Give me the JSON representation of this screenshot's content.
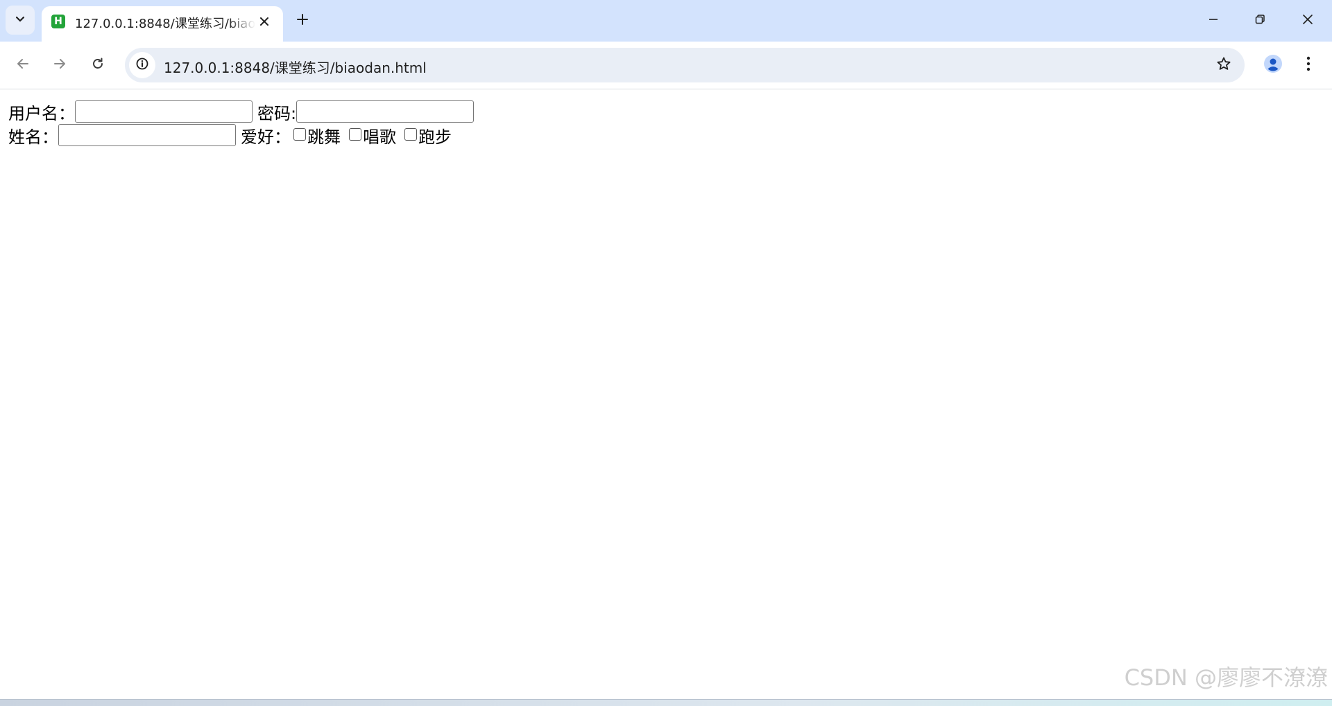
{
  "browser": {
    "tab": {
      "title": "127.0.0.1:8848/课堂练习/biaodan.html",
      "favicon_letter": "H",
      "favicon_color": "#23a43a"
    },
    "address_bar": {
      "url": "127.0.0.1:8848/课堂练习/biaodan.html"
    },
    "tab_strip_color": "#d3e3fd",
    "profile_color": "#1a56c4"
  },
  "form": {
    "username_label": "用户名：",
    "password_label": "密码:",
    "name_label": "姓名：",
    "hobby_label": "爱好：",
    "hobbies": [
      {
        "label": "跳舞",
        "checked": false
      },
      {
        "label": "唱歌",
        "checked": false
      },
      {
        "label": "跑步",
        "checked": false
      }
    ],
    "username_value": "",
    "password_value": "",
    "name_value": ""
  },
  "watermark": "CSDN @廖廖不潦潦"
}
